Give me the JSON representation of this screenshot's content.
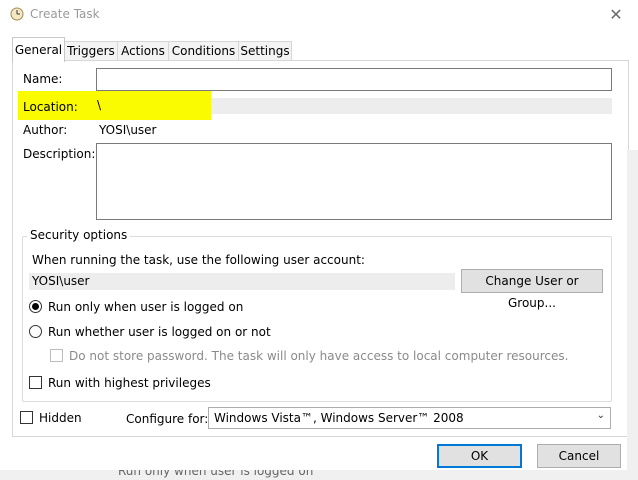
{
  "window": {
    "title": "Create Task",
    "close_glyph": "✕"
  },
  "tabs": [
    {
      "label": "General",
      "active": true
    },
    {
      "label": "Triggers",
      "active": false
    },
    {
      "label": "Actions",
      "active": false
    },
    {
      "label": "Conditions",
      "active": false
    },
    {
      "label": "Settings",
      "active": false
    }
  ],
  "general": {
    "name_label": "Name:",
    "name_value": "",
    "location_label": "Location:",
    "location_value": "\\",
    "author_label": "Author:",
    "author_value": "YOSI\\user",
    "description_label": "Description:",
    "description_value": ""
  },
  "security": {
    "group_title": "Security options",
    "account_prompt": "When running the task, use the following user account:",
    "account_value": "YOSI\\user",
    "change_button": "Change User or Group...",
    "radio_logged_on": "Run only when user is logged on",
    "radio_whether": "Run whether user is logged on or not",
    "no_store_password": "Do not store password.  The task will only have access to local computer resources.",
    "highest_privileges": "Run with highest privileges"
  },
  "footer": {
    "hidden_label": "Hidden",
    "configure_label": "Configure for:",
    "configure_value": "Windows Vista™, Windows Server™ 2008",
    "ok": "OK",
    "cancel": "Cancel"
  },
  "background_text": "Run only when user is logged on",
  "colors": {
    "highlight": "#fbfb00",
    "accent": "#0078d7"
  },
  "state": {
    "selected_radio": "logged_on",
    "hidden_checked": false,
    "highest_checked": false,
    "no_store_enabled": false
  }
}
